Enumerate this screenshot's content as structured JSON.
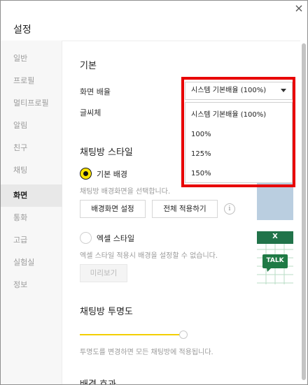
{
  "window": {
    "title": "설정",
    "close_icon": "close-icon"
  },
  "sidebar": {
    "items": [
      {
        "label": "일반"
      },
      {
        "label": "프로필"
      },
      {
        "label": "멀티프로필"
      },
      {
        "label": "알림"
      },
      {
        "label": "친구"
      },
      {
        "label": "채팅"
      },
      {
        "label": "화면"
      },
      {
        "label": "통화"
      },
      {
        "label": "고급"
      },
      {
        "label": "실험실"
      },
      {
        "label": "정보"
      }
    ],
    "active": "화면"
  },
  "basic": {
    "heading": "기본",
    "zoom_label": "화면 배율",
    "font_label": "글씨체",
    "zoom_select": {
      "value": "시스템 기본배율 (100%)",
      "options": [
        "시스템 기본배율 (100%)",
        "100%",
        "125%",
        "150%"
      ]
    }
  },
  "chat_style": {
    "heading": "채팅방 스타일",
    "default_bg": {
      "label": "기본 배경",
      "desc": "채팅방 배경화면을 선택합니다.",
      "selected": true
    },
    "set_bg_button": "배경화면 설정",
    "apply_all_button": "전체 적용하기",
    "info_icon": "i",
    "excel_style": {
      "label": "엑셀 스타일",
      "desc": "엑셀 스타일 적용시 배경을 설정할 수 없습니다.",
      "selected": false
    },
    "preview_button": "미리보기",
    "excel_preview": {
      "x_mark": "X",
      "talk_badge": "TALK"
    }
  },
  "transparency": {
    "heading": "채팅방 투명도",
    "desc": "투명도를 변경하면 모든 채팅방에 적용됩니다.",
    "value": 1.0
  },
  "bg_effect": {
    "heading": "배경 효과"
  },
  "colors": {
    "accent_yellow": "#ffe500",
    "highlight_red": "#e80000",
    "excel_green": "#21734a",
    "talk_green": "#1f7a45",
    "preview_blue": "#bacee0"
  }
}
